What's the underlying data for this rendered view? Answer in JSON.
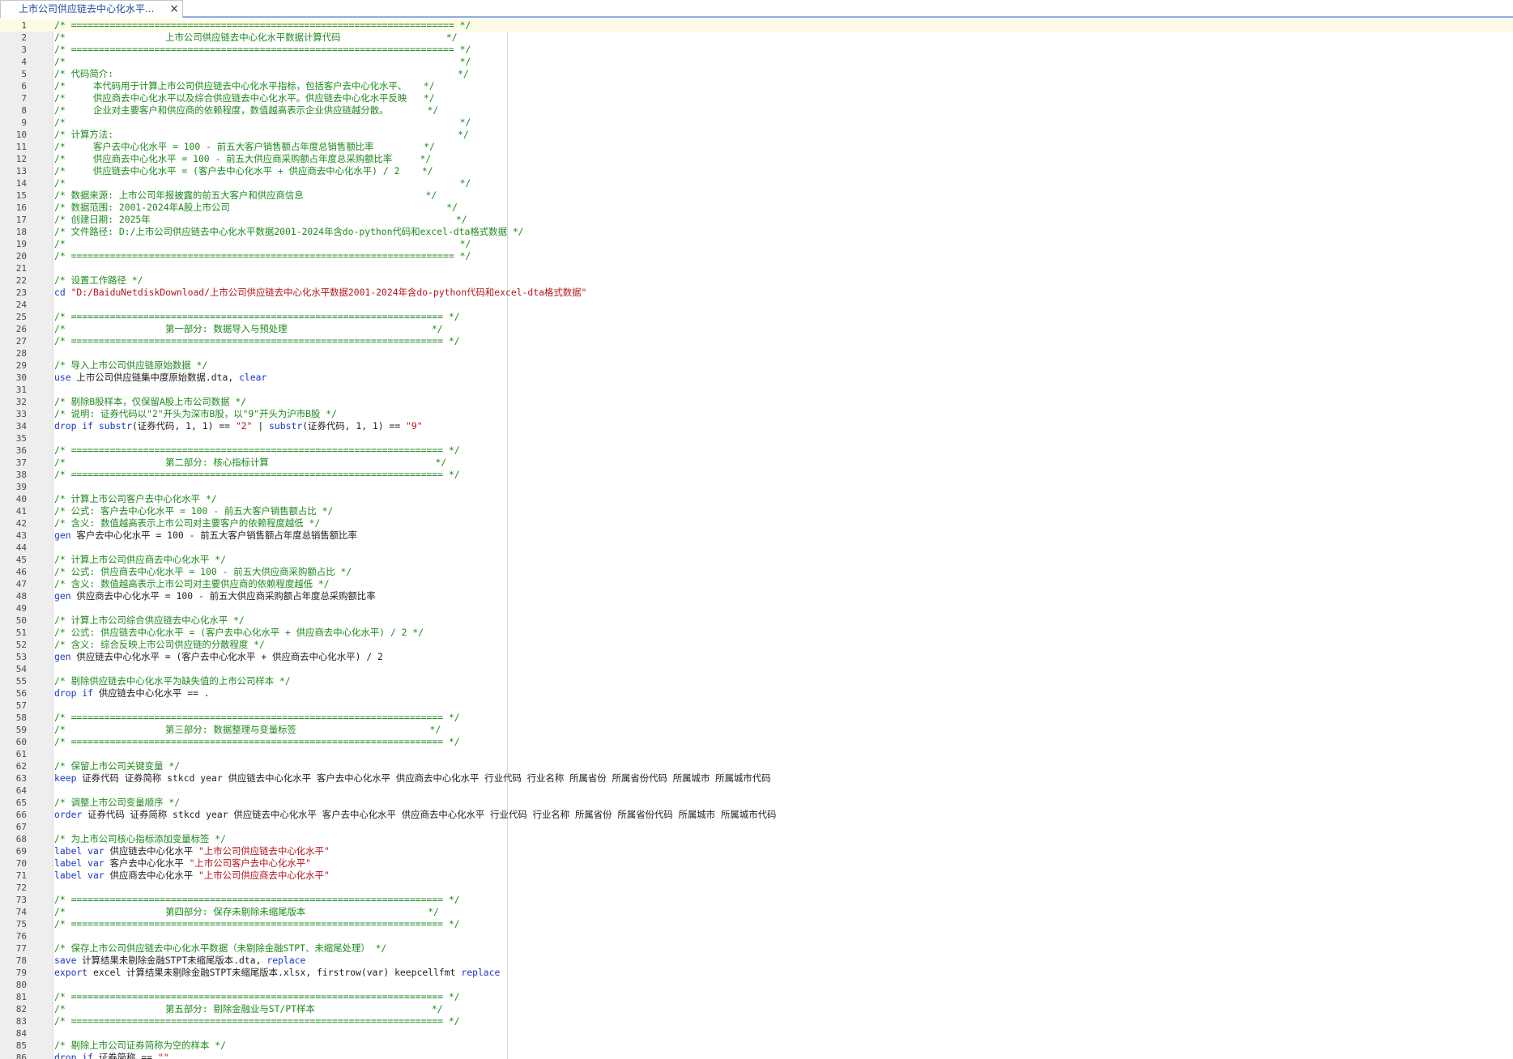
{
  "tab": {
    "title": "上市公司供应链去中心化水平...",
    "close_glyph": "×"
  },
  "lines": [
    [
      [
        "c",
        "/* ===================================================================== */"
      ]
    ],
    [
      [
        "c",
        "/*                  上市公司供应链去中心化水平数据计算代码                   */"
      ]
    ],
    [
      [
        "c",
        "/* ===================================================================== */"
      ]
    ],
    [
      [
        "c",
        "/*                                                                       */"
      ]
    ],
    [
      [
        "c",
        "/* 代码简介:                                                              */"
      ]
    ],
    [
      [
        "c",
        "/*     本代码用于计算上市公司供应链去中心化水平指标，包括客户去中心化水平、   */"
      ]
    ],
    [
      [
        "c",
        "/*     供应商去中心化水平以及综合供应链去中心化水平。供应链去中心化水平反映   */"
      ]
    ],
    [
      [
        "c",
        "/*     企业对主要客户和供应商的依赖程度，数值越高表示企业供应链越分散。       */"
      ]
    ],
    [
      [
        "c",
        "/*                                                                       */"
      ]
    ],
    [
      [
        "c",
        "/* 计算方法:                                                              */"
      ]
    ],
    [
      [
        "c",
        "/*     客户去中心化水平 = 100 - 前五大客户销售额占年度总销售额比率         */"
      ]
    ],
    [
      [
        "c",
        "/*     供应商去中心化水平 = 100 - 前五大供应商采购额占年度总采购额比率     */"
      ]
    ],
    [
      [
        "c",
        "/*     供应链去中心化水平 = (客户去中心化水平 + 供应商去中心化水平) / 2    */"
      ]
    ],
    [
      [
        "c",
        "/*                                                                       */"
      ]
    ],
    [
      [
        "c",
        "/* 数据来源: 上市公司年报披露的前五大客户和供应商信息                      */"
      ]
    ],
    [
      [
        "c",
        "/* 数据范围: 2001-2024年A股上市公司                                       */"
      ]
    ],
    [
      [
        "c",
        "/* 创建日期: 2025年                                                       */"
      ]
    ],
    [
      [
        "c",
        "/* 文件路径: D:/上市公司供应链去中心化水平数据2001-2024年含do-python代码和excel-dta格式数据 */"
      ]
    ],
    [
      [
        "c",
        "/*                                                                       */"
      ]
    ],
    [
      [
        "c",
        "/* ===================================================================== */"
      ]
    ],
    [],
    [
      [
        "c",
        "/* 设置工作路径 */"
      ]
    ],
    [
      [
        "k",
        "cd "
      ],
      [
        "s",
        "\"D:/BaiduNetdiskDownload/上市公司供应链去中心化水平数据2001-2024年含do-python代码和excel-dta格式数据\""
      ]
    ],
    [],
    [
      [
        "c",
        "/* =================================================================== */"
      ]
    ],
    [
      [
        "c",
        "/*                  第一部分: 数据导入与预处理                          */"
      ]
    ],
    [
      [
        "c",
        "/* =================================================================== */"
      ]
    ],
    [],
    [
      [
        "c",
        "/* 导入上市公司供应链原始数据 */"
      ]
    ],
    [
      [
        "k",
        "use"
      ],
      [
        "t",
        " 上市公司供应链集中度原始数据.dta, "
      ],
      [
        "k",
        "clear"
      ]
    ],
    [],
    [
      [
        "c",
        "/* 剔除B股样本，仅保留A股上市公司数据 */"
      ]
    ],
    [
      [
        "c",
        "/* 说明: 证券代码以\"2\"开头为深市B股，以\"9\"开头为沪市B股 */"
      ]
    ],
    [
      [
        "k",
        "drop if "
      ],
      [
        "k",
        "substr"
      ],
      [
        "t",
        "(证券代码, 1, 1) == "
      ],
      [
        "s",
        "\"2\""
      ],
      [
        "t",
        " | "
      ],
      [
        "k",
        "substr"
      ],
      [
        "t",
        "(证券代码, 1, 1) == "
      ],
      [
        "s",
        "\"9\""
      ]
    ],
    [],
    [
      [
        "c",
        "/* =================================================================== */"
      ]
    ],
    [
      [
        "c",
        "/*                  第二部分: 核心指标计算                              */"
      ]
    ],
    [
      [
        "c",
        "/* =================================================================== */"
      ]
    ],
    [],
    [
      [
        "c",
        "/* 计算上市公司客户去中心化水平 */"
      ]
    ],
    [
      [
        "c",
        "/* 公式: 客户去中心化水平 = 100 - 前五大客户销售额占比 */"
      ]
    ],
    [
      [
        "c",
        "/* 含义: 数值越高表示上市公司对主要客户的依赖程度越低 */"
      ]
    ],
    [
      [
        "k",
        "gen"
      ],
      [
        "t",
        " 客户去中心化水平 = 100 - 前五大客户销售额占年度总销售额比率"
      ]
    ],
    [],
    [
      [
        "c",
        "/* 计算上市公司供应商去中心化水平 */"
      ]
    ],
    [
      [
        "c",
        "/* 公式: 供应商去中心化水平 = 100 - 前五大供应商采购额占比 */"
      ]
    ],
    [
      [
        "c",
        "/* 含义: 数值越高表示上市公司对主要供应商的依赖程度越低 */"
      ]
    ],
    [
      [
        "k",
        "gen"
      ],
      [
        "t",
        " 供应商去中心化水平 = 100 - 前五大供应商采购额占年度总采购额比率"
      ]
    ],
    [],
    [
      [
        "c",
        "/* 计算上市公司综合供应链去中心化水平 */"
      ]
    ],
    [
      [
        "c",
        "/* 公式: 供应链去中心化水平 = (客户去中心化水平 + 供应商去中心化水平) / 2 */"
      ]
    ],
    [
      [
        "c",
        "/* 含义: 综合反映上市公司供应链的分散程度 */"
      ]
    ],
    [
      [
        "k",
        "gen"
      ],
      [
        "t",
        " 供应链去中心化水平 = (客户去中心化水平 + 供应商去中心化水平) / 2"
      ]
    ],
    [],
    [
      [
        "c",
        "/* 剔除供应链去中心化水平为缺失值的上市公司样本 */"
      ]
    ],
    [
      [
        "k",
        "drop if"
      ],
      [
        "t",
        " 供应链去中心化水平 == ."
      ]
    ],
    [],
    [
      [
        "c",
        "/* =================================================================== */"
      ]
    ],
    [
      [
        "c",
        "/*                  第三部分: 数据整理与变量标签                        */"
      ]
    ],
    [
      [
        "c",
        "/* =================================================================== */"
      ]
    ],
    [],
    [
      [
        "c",
        "/* 保留上市公司关键变量 */"
      ]
    ],
    [
      [
        "k",
        "keep"
      ],
      [
        "t",
        " 证券代码 证券简称 stkcd year 供应链去中心化水平 客户去中心化水平 供应商去中心化水平 行业代码 行业名称 所属省份 所属省份代码 所属城市 所属城市代码"
      ]
    ],
    [],
    [
      [
        "c",
        "/* 调整上市公司变量顺序 */"
      ]
    ],
    [
      [
        "k",
        "order"
      ],
      [
        "t",
        " 证券代码 证券简称 stkcd year 供应链去中心化水平 客户去中心化水平 供应商去中心化水平 行业代码 行业名称 所属省份 所属省份代码 所属城市 所属城市代码"
      ]
    ],
    [],
    [
      [
        "c",
        "/* 为上市公司核心指标添加变量标签 */"
      ]
    ],
    [
      [
        "k",
        "label var"
      ],
      [
        "t",
        " 供应链去中心化水平 "
      ],
      [
        "s",
        "\"上市公司供应链去中心化水平\""
      ]
    ],
    [
      [
        "k",
        "label var"
      ],
      [
        "t",
        " 客户去中心化水平 "
      ],
      [
        "s",
        "\"上市公司客户去中心化水平\""
      ]
    ],
    [
      [
        "k",
        "label var"
      ],
      [
        "t",
        " 供应商去中心化水平 "
      ],
      [
        "s",
        "\"上市公司供应商去中心化水平\""
      ]
    ],
    [],
    [
      [
        "c",
        "/* =================================================================== */"
      ]
    ],
    [
      [
        "c",
        "/*                  第四部分: 保存未剔除未缩尾版本                      */"
      ]
    ],
    [
      [
        "c",
        "/* =================================================================== */"
      ]
    ],
    [],
    [
      [
        "c",
        "/* 保存上市公司供应链去中心化水平数据（未剔除金融STPT、未缩尾处理） */"
      ]
    ],
    [
      [
        "k",
        "save"
      ],
      [
        "t",
        " 计算结果未剔除金融STPT未缩尾版本.dta, "
      ],
      [
        "k",
        "replace"
      ]
    ],
    [
      [
        "k",
        "export"
      ],
      [
        "t",
        " excel 计算结果未剔除金融STPT未缩尾版本.xlsx, firstrow(var) keepcellfmt "
      ],
      [
        "k",
        "replace"
      ]
    ],
    [],
    [
      [
        "c",
        "/* =================================================================== */"
      ]
    ],
    [
      [
        "c",
        "/*                  第五部分: 剔除金融业与ST/PT样本                     */"
      ]
    ],
    [
      [
        "c",
        "/* =================================================================== */"
      ]
    ],
    [],
    [
      [
        "c",
        "/* 剔除上市公司证券简称为空的样本 */"
      ]
    ],
    [
      [
        "k",
        "drop if"
      ],
      [
        "t",
        " 证券简称 == "
      ],
      [
        "s",
        "\"\""
      ]
    ]
  ]
}
